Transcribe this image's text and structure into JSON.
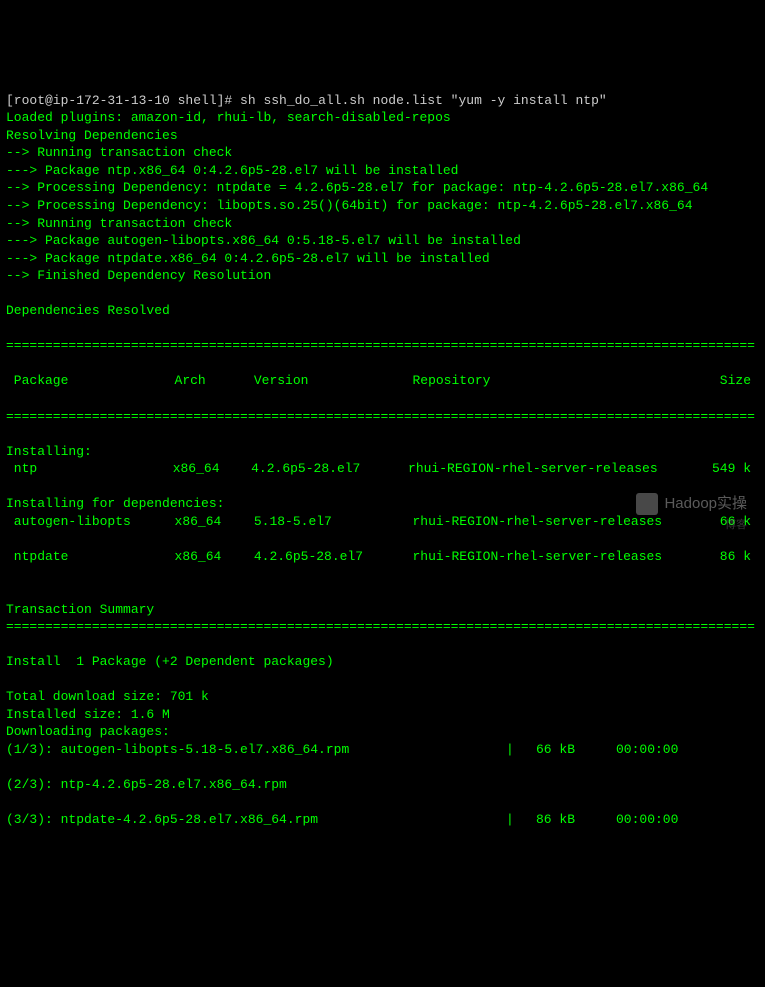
{
  "prompt": {
    "user_host": "[root@ip-172-31-13-10 shell]#",
    "command": " sh ssh_do_all.sh node.list \"yum -y install ntp\""
  },
  "messages": {
    "loaded_plugins": "Loaded plugins: amazon-id, rhui-lb, search-disabled-repos",
    "resolving": "Resolving Dependencies",
    "check1": "--> Running transaction check",
    "pkg_ntp": "---> Package ntp.x86_64 0:4.2.6p5-28.el7 will be installed",
    "dep1": "--> Processing Dependency: ntpdate = 4.2.6p5-28.el7 for package: ntp-4.2.6p5-28.el7.x86_64",
    "dep2": "--> Processing Dependency: libopts.so.25()(64bit) for package: ntp-4.2.6p5-28.el7.x86_64",
    "check2": "--> Running transaction check",
    "pkg_libopts": "---> Package autogen-libopts.x86_64 0:5.18-5.el7 will be installed",
    "pkg_ntpdate": "---> Package ntpdate.x86_64 0:4.2.6p5-28.el7 will be installed",
    "finished": "--> Finished Dependency Resolution",
    "deps_resolved": "Dependencies Resolved",
    "installing_hdr": "Installing:",
    "installing_deps_hdr": "Installing for dependencies:",
    "trans_summary": "Transaction Summary",
    "install_count": "Install  1 Package (+2 Dependent packages)",
    "total_dl": "Total download size: 701 k",
    "installed_size": "Installed size: 1.6 M",
    "downloading": "Downloading packages:"
  },
  "table_headers": {
    "package": " Package",
    "arch": "Arch",
    "version": "Version",
    "repository": "Repository",
    "size": "Size"
  },
  "packages": {
    "install": [
      {
        "name": " ntp",
        "arch": "x86_64",
        "version": "4.2.6p5-28.el7",
        "repo": "rhui-REGION-rhel-server-releases",
        "size": "549 k"
      }
    ],
    "deps": [
      {
        "name": " autogen-libopts",
        "arch": "x86_64",
        "version": "5.18-5.el7",
        "repo": "rhui-REGION-rhel-server-releases",
        "size": "66 k"
      },
      {
        "name": " ntpdate",
        "arch": "x86_64",
        "version": "4.2.6p5-28.el7",
        "repo": "rhui-REGION-rhel-server-releases",
        "size": "86 k"
      }
    ]
  },
  "downloads": [
    {
      "label": "(1/3): autogen-libopts-5.18-5.el7.x86_64.rpm",
      "size": "66 kB",
      "time": "00:00:00"
    },
    {
      "label": "(2/3): ntp-4.2.6p5-28.el7.x86_64.rpm",
      "size": "",
      "time": ""
    },
    {
      "label": "(3/3): ntpdate-4.2.6p5-28.el7.x86_64.rpm",
      "size": "86 kB",
      "time": "00:00:00"
    }
  ],
  "divider": "================================================================================================",
  "watermark": "Hadoop实操",
  "sub_watermark": "博客"
}
